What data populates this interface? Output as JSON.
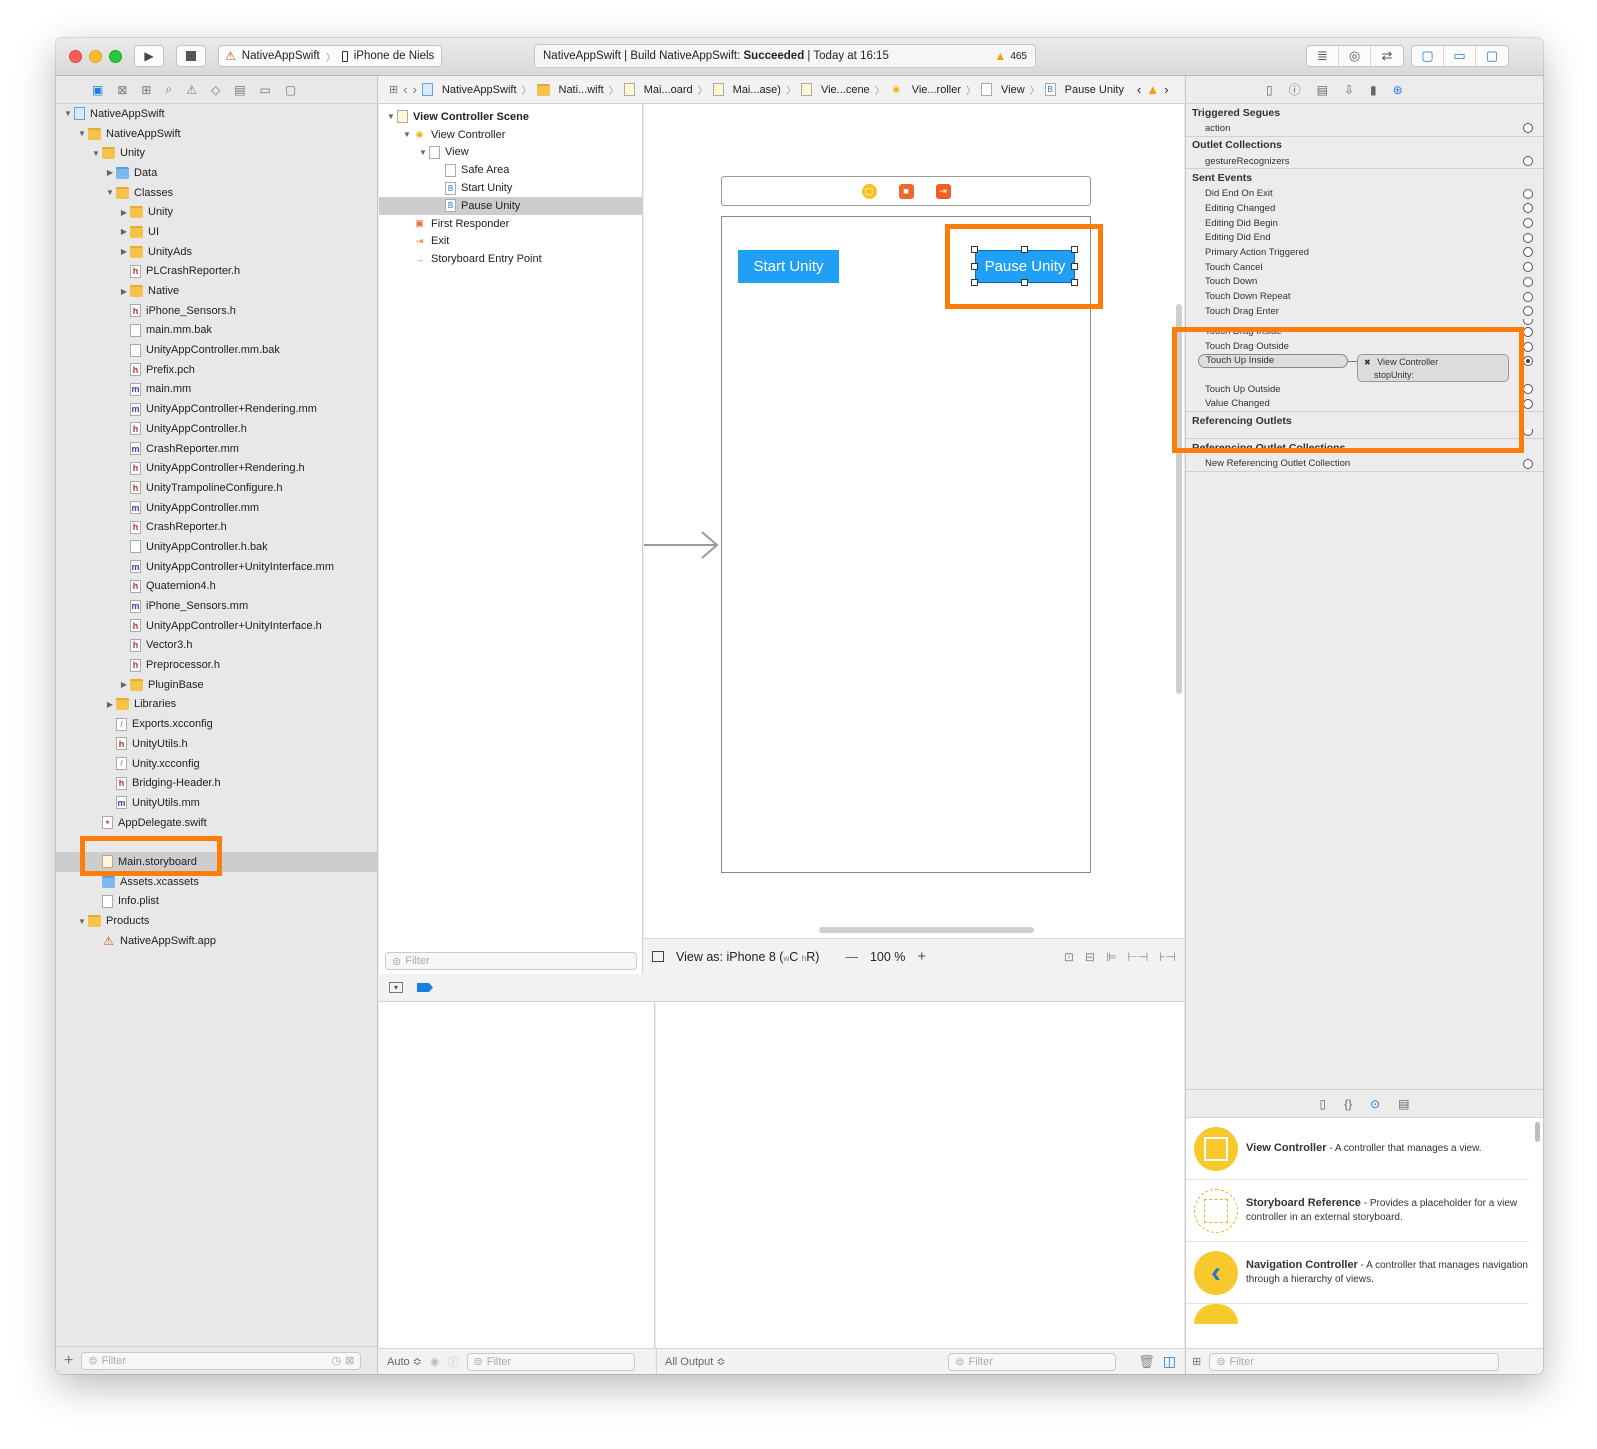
{
  "toolbar": {
    "scheme": "NativeAppSwift",
    "device": "iPhone de Niels",
    "activity_project": "NativeAppSwift | Build NativeAppSwift: ",
    "activity_status": "Succeeded",
    "activity_time": " | Today at 16:15",
    "warning_count": "465"
  },
  "navigator": {
    "filter_placeholder": "Filter",
    "items": [
      {
        "label": "NativeAppSwift",
        "indent": 0,
        "disclosure": "open",
        "icon": "project-icon"
      },
      {
        "label": "NativeAppSwift",
        "indent": 1,
        "disclosure": "open",
        "icon": "folder-icon"
      },
      {
        "label": "Unity",
        "indent": 2,
        "disclosure": "open",
        "icon": "folder-icon"
      },
      {
        "label": "Data",
        "indent": 3,
        "disclosure": "closed",
        "icon": "blue-folder-icon"
      },
      {
        "label": "Classes",
        "indent": 3,
        "disclosure": "open",
        "icon": "folder-icon"
      },
      {
        "label": "Unity",
        "indent": 4,
        "disclosure": "closed",
        "icon": "folder-icon"
      },
      {
        "label": "UI",
        "indent": 4,
        "disclosure": "closed",
        "icon": "folder-icon"
      },
      {
        "label": "UnityAds",
        "indent": 4,
        "disclosure": "closed",
        "icon": "folder-icon"
      },
      {
        "label": "PLCrashReporter.h",
        "indent": 4,
        "disclosure": "none",
        "icon": "h-file-icon"
      },
      {
        "label": "Native",
        "indent": 4,
        "disclosure": "closed",
        "icon": "folder-icon"
      },
      {
        "label": "iPhone_Sensors.h",
        "indent": 4,
        "disclosure": "none",
        "icon": "h-file-icon"
      },
      {
        "label": "main.mm.bak",
        "indent": 4,
        "disclosure": "none",
        "icon": "generic-file-icon"
      },
      {
        "label": "UnityAppController.mm.bak",
        "indent": 4,
        "disclosure": "none",
        "icon": "generic-file-icon"
      },
      {
        "label": "Prefix.pch",
        "indent": 4,
        "disclosure": "none",
        "icon": "h-file-icon"
      },
      {
        "label": "main.mm",
        "indent": 4,
        "disclosure": "none",
        "icon": "m-file-icon"
      },
      {
        "label": "UnityAppController+Rendering.mm",
        "indent": 4,
        "disclosure": "none",
        "icon": "m-file-icon"
      },
      {
        "label": "UnityAppController.h",
        "indent": 4,
        "disclosure": "none",
        "icon": "h-file-icon"
      },
      {
        "label": "CrashReporter.mm",
        "indent": 4,
        "disclosure": "none",
        "icon": "m-file-icon"
      },
      {
        "label": "UnityAppController+Rendering.h",
        "indent": 4,
        "disclosure": "none",
        "icon": "h-file-icon"
      },
      {
        "label": "UnityTrampolineConfigure.h",
        "indent": 4,
        "disclosure": "none",
        "icon": "h-file-icon"
      },
      {
        "label": "UnityAppController.mm",
        "indent": 4,
        "disclosure": "none",
        "icon": "m-file-icon"
      },
      {
        "label": "CrashReporter.h",
        "indent": 4,
        "disclosure": "none",
        "icon": "h-file-icon"
      },
      {
        "label": "UnityAppController.h.bak",
        "indent": 4,
        "disclosure": "none",
        "icon": "generic-file-icon"
      },
      {
        "label": "UnityAppController+UnityInterface.mm",
        "indent": 4,
        "disclosure": "none",
        "icon": "m-file-icon"
      },
      {
        "label": "Quaternion4.h",
        "indent": 4,
        "disclosure": "none",
        "icon": "h-file-icon"
      },
      {
        "label": "iPhone_Sensors.mm",
        "indent": 4,
        "disclosure": "none",
        "icon": "m-file-icon"
      },
      {
        "label": "UnityAppController+UnityInterface.h",
        "indent": 4,
        "disclosure": "none",
        "icon": "h-file-icon"
      },
      {
        "label": "Vector3.h",
        "indent": 4,
        "disclosure": "none",
        "icon": "h-file-icon"
      },
      {
        "label": "Preprocessor.h",
        "indent": 4,
        "disclosure": "none",
        "icon": "h-file-icon"
      },
      {
        "label": "PluginBase",
        "indent": 4,
        "disclosure": "closed",
        "icon": "folder-icon"
      },
      {
        "label": "Libraries",
        "indent": 3,
        "disclosure": "closed",
        "icon": "folder-icon"
      },
      {
        "label": "Exports.xcconfig",
        "indent": 3,
        "disclosure": "none",
        "icon": "xcconfig-file-icon"
      },
      {
        "label": "UnityUtils.h",
        "indent": 3,
        "disclosure": "none",
        "icon": "h-file-icon"
      },
      {
        "label": "Unity.xcconfig",
        "indent": 3,
        "disclosure": "none",
        "icon": "xcconfig-file-icon"
      },
      {
        "label": "Bridging-Header.h",
        "indent": 3,
        "disclosure": "none",
        "icon": "h-file-icon"
      },
      {
        "label": "UnityUtils.mm",
        "indent": 3,
        "disclosure": "none",
        "icon": "m-file-icon"
      },
      {
        "label": "AppDelegate.swift",
        "indent": 2,
        "disclosure": "none",
        "icon": "swift-file-icon"
      },
      {
        "label": "",
        "indent": 2,
        "disclosure": "none",
        "icon": "none"
      },
      {
        "label": "Main.storyboard",
        "indent": 2,
        "disclosure": "none",
        "icon": "storyboard-file-icon",
        "selected": true
      },
      {
        "label": "Assets.xcassets",
        "indent": 2,
        "disclosure": "none",
        "icon": "blue-folder-icon"
      },
      {
        "label": "Info.plist",
        "indent": 2,
        "disclosure": "none",
        "icon": "generic-file-icon"
      },
      {
        "label": "Products",
        "indent": 1,
        "disclosure": "open",
        "icon": "folder-icon"
      },
      {
        "label": "NativeAppSwift.app",
        "indent": 2,
        "disclosure": "none",
        "icon": "app-icon"
      }
    ]
  },
  "jumpbar": {
    "crumbs": [
      {
        "label": "NativeAppSwift",
        "icon": "project-icon"
      },
      {
        "label": "Nati...wift",
        "icon": "folder-icon"
      },
      {
        "label": "Mai...oard",
        "icon": "storyboard-file-icon"
      },
      {
        "label": "Mai...ase)",
        "icon": "storyboard-file-icon"
      },
      {
        "label": "Vie...cene",
        "icon": "scene-icon"
      },
      {
        "label": "Vie...roller",
        "icon": "view-controller-icon"
      },
      {
        "label": "View",
        "icon": "view-icon"
      },
      {
        "label": "Pause Unity",
        "icon": "button-icon"
      }
    ]
  },
  "outline": {
    "filter_placeholder": "Filter",
    "items": [
      {
        "label": "View Controller Scene",
        "indent": 0,
        "disclosure": "open",
        "bold": true,
        "icon": "scene-icon"
      },
      {
        "label": "View Controller",
        "indent": 1,
        "disclosure": "open",
        "icon": "view-controller-icon"
      },
      {
        "label": "View",
        "indent": 2,
        "disclosure": "open",
        "icon": "view-icon"
      },
      {
        "label": "Safe Area",
        "indent": 3,
        "disclosure": "none",
        "icon": "safe-area-icon"
      },
      {
        "label": "Start Unity",
        "indent": 3,
        "disclosure": "none",
        "icon": "button-icon"
      },
      {
        "label": "Pause Unity",
        "indent": 3,
        "disclosure": "none",
        "icon": "button-icon",
        "selected": true
      },
      {
        "label": "First Responder",
        "indent": 1,
        "disclosure": "none",
        "icon": "first-responder-icon"
      },
      {
        "label": "Exit",
        "indent": 1,
        "disclosure": "none",
        "icon": "exit-icon"
      },
      {
        "label": "Storyboard Entry Point",
        "indent": 1,
        "disclosure": "none",
        "icon": "entry-arrow-icon"
      }
    ]
  },
  "canvas": {
    "start_button": "Start Unity",
    "pause_button": "Pause Unity",
    "view_as_prefix": "View as: iPhone 8 (",
    "view_as_w": "w",
    "view_as_c": "C",
    "view_as_h": "h",
    "view_as_r": "R)",
    "zoom": "100 %"
  },
  "debug": {
    "auto_label": "Auto ≎",
    "output_label": "All Output ≎",
    "filter_placeholder": "Filter"
  },
  "inspector": {
    "triggered_segues_title": "Triggered Segues",
    "triggered_segues": [
      "action"
    ],
    "outlet_collections_title": "Outlet Collections",
    "outlet_collections": [
      "gestureRecognizers"
    ],
    "sent_events_title": "Sent Events",
    "sent_events_top": [
      "Did End On Exit",
      "Editing Changed",
      "Editing Did Begin",
      "Editing Did End",
      "Primary Action Triggered",
      "Touch Cancel",
      "Touch Down",
      "Touch Down Repeat",
      "Touch Drag Enter"
    ],
    "sent_events_bottom": [
      "Touch Drag Inside",
      "Touch Drag Outside"
    ],
    "connected_event": "Touch Up Inside",
    "connection_target": "View Controller",
    "connection_action": "stopUnity:",
    "sent_events_after": [
      "Touch Up Outside",
      "Value Changed"
    ],
    "referencing_outlets_title": "Referencing Outlets",
    "referencing_outlet_collections_title": "Referencing Outlet Collections",
    "referencing_outlet_collections": [
      "New Referencing Outlet Collection"
    ]
  },
  "library": {
    "filter_placeholder": "Filter",
    "items": [
      {
        "name": "View Controller",
        "desc": " - A controller that manages a view."
      },
      {
        "name": "Storyboard Reference",
        "desc": " - Provides a placeholder for a view controller in an external storyboard."
      },
      {
        "name": "Navigation Controller",
        "desc": " - A controller that manages navigation through a hierarchy of views."
      }
    ]
  },
  "colors": {
    "highlight": "#fd7d0b",
    "button_blue": "#1fa0f5",
    "accent": "#1a7ce5"
  }
}
